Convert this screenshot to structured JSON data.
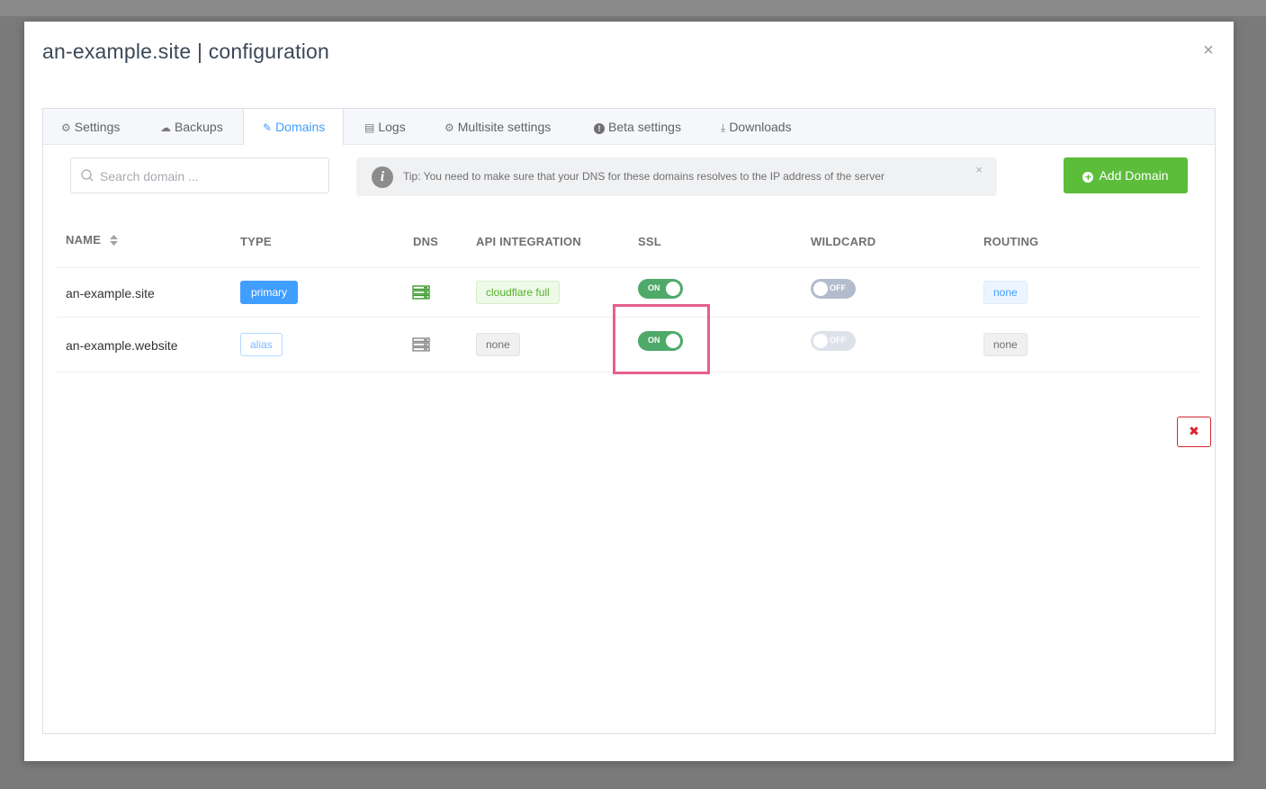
{
  "modal": {
    "title": "an-example.site | configuration",
    "close_icon": "×"
  },
  "tabs": [
    {
      "label": "Settings",
      "icon": "gear-icon",
      "glyph": "⚙"
    },
    {
      "label": "Backups",
      "icon": "cloud-upload-icon",
      "glyph": "☁"
    },
    {
      "label": "Domains",
      "icon": "edit-icon",
      "glyph": "✎",
      "active": true
    },
    {
      "label": "Logs",
      "icon": "document-icon",
      "glyph": "▤"
    },
    {
      "label": "Multisite settings",
      "icon": "gear-icon",
      "glyph": "⚙"
    },
    {
      "label": "Beta settings",
      "icon": "warning-circle-icon",
      "glyph": "!"
    },
    {
      "label": "Downloads",
      "icon": "download-icon",
      "glyph": "⤓"
    }
  ],
  "search": {
    "placeholder": "Search domain ...",
    "value": ""
  },
  "tip": {
    "text": "Tip: You need to make sure that your DNS for these domains resolves to the IP address of the server",
    "info_glyph": "i",
    "close_glyph": "×"
  },
  "add_button": {
    "label": "Add Domain",
    "plus_glyph": "+"
  },
  "table": {
    "headers": {
      "name": "NAME",
      "type": "TYPE",
      "dns": "DNS",
      "api": "API INTEGRATION",
      "ssl": "SSL",
      "wildcard": "WILDCARD",
      "routing": "ROUTING"
    },
    "rows": [
      {
        "name": "an-example.site",
        "type": "primary",
        "dns_status": "ok",
        "api": "cloudflare full",
        "ssl": "ON",
        "wildcard": "OFF",
        "routing": "none"
      },
      {
        "name": "an-example.website",
        "type": "alias",
        "dns_status": "unknown",
        "api": "none",
        "ssl": "ON",
        "wildcard": "OFF",
        "routing": "none",
        "delete_glyph": "✖"
      }
    ]
  },
  "colors": {
    "accent": "#409eff",
    "success": "#5bbd3a",
    "toggle_on": "#4faa6a",
    "danger": "#d9242f",
    "highlight": "#e6608a"
  }
}
